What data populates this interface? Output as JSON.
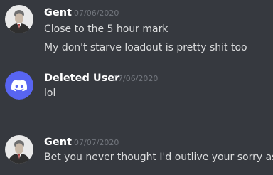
{
  "messages": [
    {
      "author": "Gent",
      "timestamp": "07/06/2020",
      "avatar_icon": "user-portrait-icon",
      "lines": [
        "Close to the 5 hour mark",
        "My don't starve loadout is pretty shit too"
      ]
    },
    {
      "author": "Deleted User",
      "timestamp": "07/06/2020",
      "avatar_icon": "discord-logo-icon",
      "avatar_color": "#5865f2",
      "lines": [
        "lol"
      ]
    },
    {
      "author": "Gent",
      "timestamp": "07/07/2020",
      "avatar_icon": "user-portrait-icon",
      "lines": [
        "Bet you never thought I'd outlive your sorry ass"
      ]
    }
  ],
  "colors": {
    "background": "#36393f",
    "username": "#ffffff",
    "timestamp": "#72767d",
    "message_text": "#dcddde"
  }
}
